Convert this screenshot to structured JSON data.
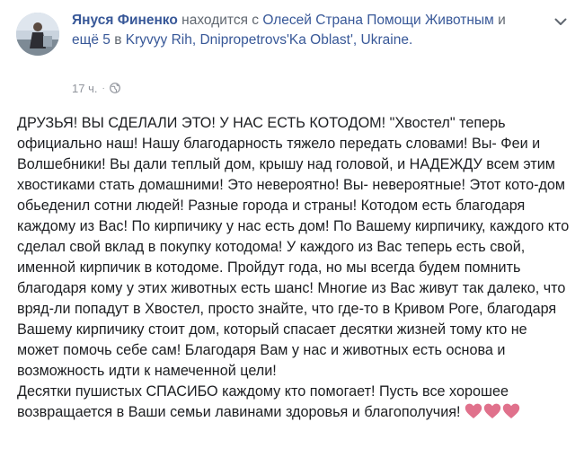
{
  "post": {
    "author": "Януся Финенко",
    "with_prefix": "находится с",
    "tagged_person": "Олесей Страна Помощи Животным",
    "and_text": "и",
    "others": "ещё 5",
    "in_text": "в",
    "location": "Kryvyy Rih, Dnipropetrovs'Ka Oblast', Ukraine.",
    "timestamp": "17 ч.",
    "separator": "·",
    "privacy_icon": "globe-icon",
    "more_icon": "chevron-down-icon",
    "body_text": "ДРУЗЬЯ! ВЫ СДЕЛАЛИ ЭТО! У НАС ЕСТЬ КОТОДОМ! \"Хвостел\" теперь официально наш! Нашу благодарность тяжело передать словами! Вы- Феи и Волшебники! Вы дали теплый дом, крышу над головой, и НАДЕЖДУ всем этим хвостиками стать домашними! Это невероятно! Вы- невероятные! Этот кото-дом обьеденил сотни людей! Разные города и страны! Котодом есть благодаря каждому из Вас! По кирпичику у нас есть дом! По Вашему кирпичику, каждого кто сделал свой вклад в покупку котодома! У каждого из Вас теперь есть свой, именной кирпичик в котодоме. Пройдут года, но мы всегда будем помнить благодаря кому у этих животных есть шанс! Многие из Вас живут так далеко, что вряд-ли попадут в Хвостел, просто знайте, что где-то в Кривом Роге, благодаря Вашему кирпичику стоит дом, который спасает десятки жизней тому кто не может помочь себе сам! Благодаря Вам у нас и животных есть основа и возможность идти к намеченной цели!\nДесятки пушистых СПАСИБО каждому кто помогает! Пусть все хорошее возвращается в Ваши семьи лавинами здоровья и благополучия!",
    "emoji_icons": [
      "heart-icon",
      "heart-icon",
      "heart-icon"
    ],
    "heart_color": "#e0718c",
    "link_color": "#385898"
  }
}
